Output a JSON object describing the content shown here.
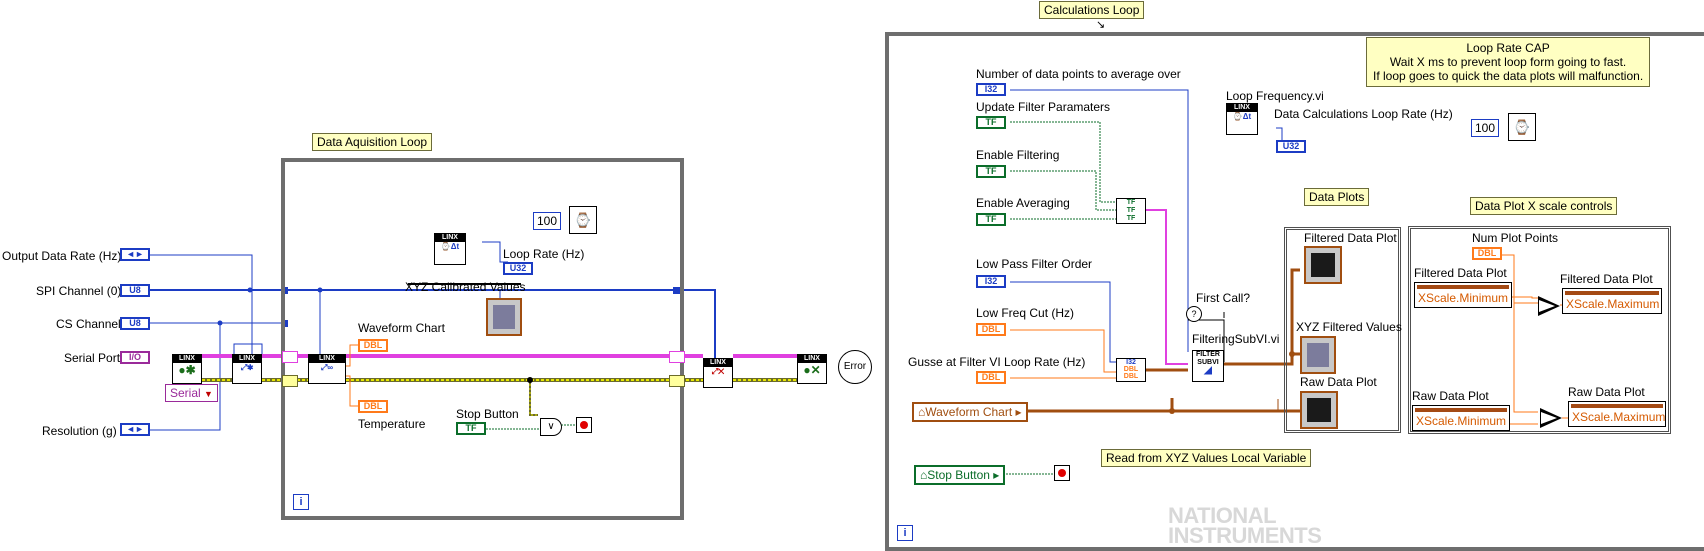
{
  "acq": {
    "title": "Data Aquisition Loop",
    "inputs": [
      "Output Data Rate (Hz)",
      "SPI Channel (0)",
      "CS Channel",
      "Serial Port",
      "Resolution (g)"
    ],
    "serial_select": "Serial",
    "loop_rate_label": "Loop Rate (Hz)",
    "xyz_label": "XYZ Calibrated Values",
    "waveform_label": "Waveform Chart",
    "temperature_label": "Temperature",
    "stop_label": "Stop Button",
    "wait_ms": "100",
    "error_text": "Error"
  },
  "calc": {
    "title": "Calculations Loop",
    "cap_note": [
      "Loop Rate CAP",
      "Wait X ms to prevent loop form going to fast.",
      "If loop goes to quick the data plots will malfunction."
    ],
    "wait_ms": "100",
    "num_points_label": "Number of data points to average over",
    "update_filter_label": "Update Filter Paramaters",
    "enable_filtering_label": "Enable Filtering",
    "enable_averaging_label": "Enable Averaging",
    "lowpass_order_label": "Low Pass Filter Order",
    "low_freq_label": "Low Freq Cut (Hz)",
    "guess_label": "Gusse at Filter VI Loop Rate (Hz)",
    "waveform_var": "Waveform Chart",
    "stop_var": "Stop Button",
    "read_note": "Read from XYZ Values  Local Variable",
    "loop_freq_vi": "Loop Frequency.vi",
    "calc_rate_label": "Data Calculations Loop Rate (Hz)",
    "first_call": "First Call?",
    "filtering_vi": "FilteringSubVI.vi",
    "data_plots": "Data Plots",
    "filtered_plot": "Filtered Data Plot",
    "xyz_filtered": "XYZ Filtered Values",
    "raw_plot": "Raw Data Plot",
    "xscale_title": "Data Plot X scale controls",
    "num_plot_points": "Num Plot Points",
    "filtered_plot_2": "Filtered Data Plot",
    "raw_plot_2": "Raw Data Plot",
    "xmin": "XScale.Minimum",
    "xmax": "XScale.Maximum"
  },
  "types": {
    "i32": "I32",
    "u8": "U8",
    "u32": "U32",
    "tf": "TF",
    "dbl": "DBL",
    "io": "I/O"
  },
  "watermark": [
    "NATIONAL",
    "INSTRUMENTS"
  ]
}
